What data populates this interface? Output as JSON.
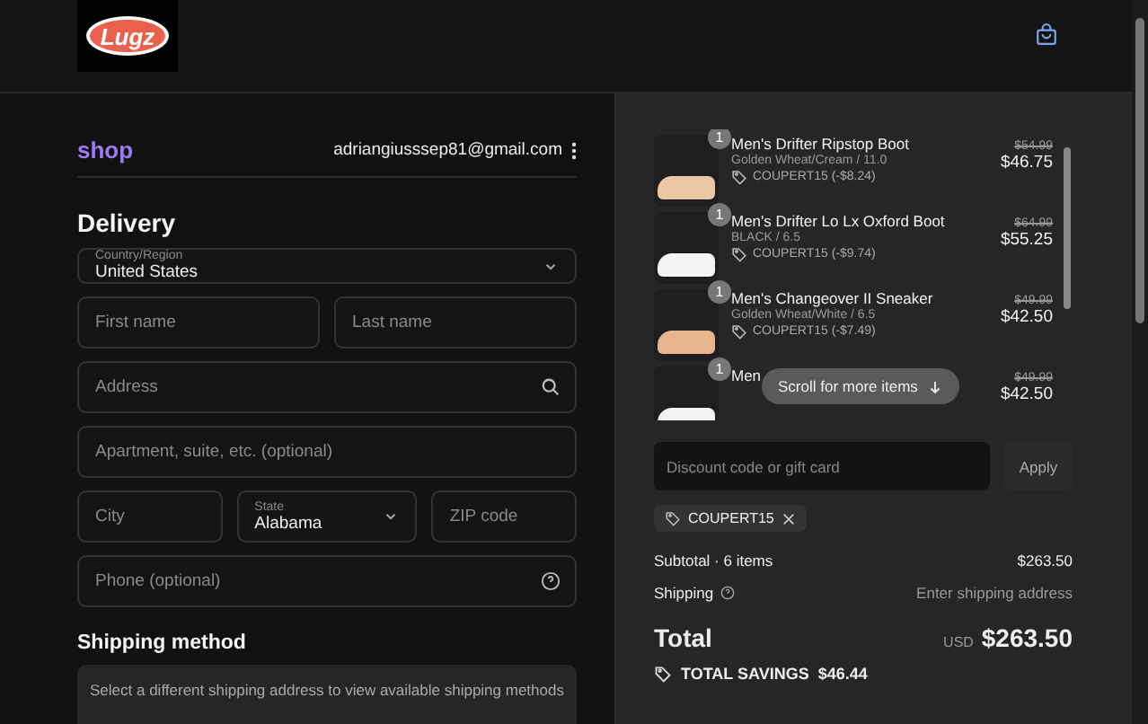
{
  "header": {
    "logo": "Lugz"
  },
  "account": {
    "brand": "shop",
    "email": "adriangiusssep81@gmail.com"
  },
  "delivery": {
    "title": "Delivery",
    "country": {
      "label": "Country/Region",
      "value": "United States"
    },
    "rows": [
      [
        {
          "kind": "input",
          "placeholder": "First name"
        },
        {
          "kind": "input",
          "placeholder": "Last name"
        }
      ],
      [
        {
          "kind": "search",
          "placeholder": "Address"
        }
      ],
      [
        {
          "kind": "input",
          "placeholder": "Apartment, suite, etc. (optional)"
        }
      ],
      [
        {
          "kind": "input",
          "placeholder": "City"
        },
        {
          "kind": "select",
          "label": "State",
          "value": "Alabama"
        },
        {
          "kind": "input",
          "placeholder": "ZIP code"
        }
      ],
      [
        {
          "kind": "help",
          "placeholder": "Phone (optional)"
        }
      ]
    ]
  },
  "shipping_method": {
    "title": "Shipping method",
    "notice": "Select a different shipping address to view available shipping methods"
  },
  "items": [
    {
      "quantity": "1",
      "name": "Men's Drifter Ripstop Boot",
      "variant": "Golden Wheat/Cream / 11.0",
      "discount": "COUPERT15 (-$8.24)",
      "old_price": "$54.99",
      "price": "$46.75",
      "color": "#e9c6a4"
    },
    {
      "quantity": "1",
      "name": "Men's Drifter Lo Lx Oxford Boot",
      "variant": "BLACK / 6.5",
      "discount": "COUPERT15 (-$9.74)",
      "old_price": "$64.99",
      "price": "$55.25",
      "color": "#f4f4f4"
    },
    {
      "quantity": "1",
      "name": "Men's Changeover II Sneaker",
      "variant": "Golden Wheat/White / 6.5",
      "discount": "COUPERT15 (-$7.49)",
      "old_price": "$49.99",
      "price": "$42.50",
      "color": "#e7b68f"
    },
    {
      "quantity": "1",
      "name": "Men",
      "old_price": "$49.99",
      "price": "$42.50",
      "color": "#f2f2f2"
    }
  ],
  "scroll_hint": "Scroll for more items",
  "discount": {
    "placeholder": "Discount code or gift card",
    "button": "Apply",
    "applied_code": "COUPERT15"
  },
  "summary": {
    "subtotal_label": "Subtotal · 6 items",
    "subtotal": "$263.50",
    "shipping_label": "Shipping",
    "shipping_value": "Enter shipping address",
    "total_label": "Total",
    "currency": "USD",
    "total": "$263.50",
    "savings_label": "TOTAL SAVINGS",
    "savings": "$46.44"
  }
}
